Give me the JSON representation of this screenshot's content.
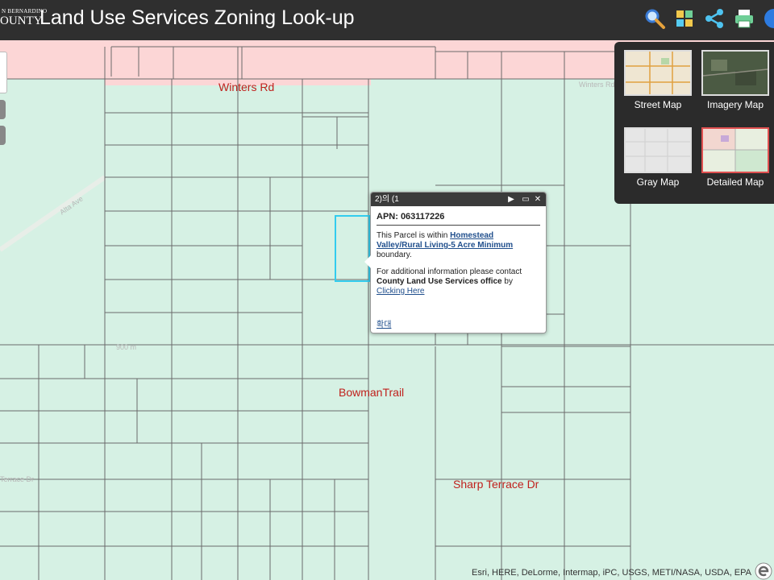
{
  "header": {
    "logo_line1": "N BERNARDINO",
    "logo_line2": "OUNTY",
    "title": "Land Use Services Zoning Look-up"
  },
  "toolbar": {
    "icons": [
      "search-icon",
      "basemap-gallery-icon",
      "share-icon",
      "print-icon",
      "info-icon"
    ]
  },
  "basemaps": [
    {
      "label": "Street Map",
      "selected": false
    },
    {
      "label": "Imagery Map",
      "selected": false
    },
    {
      "label": "Gray Map",
      "selected": false
    },
    {
      "label": "Detailed Map",
      "selected": true
    }
  ],
  "map": {
    "labels": {
      "winters_rd": "Winters Rd",
      "bowman_trail": "BowmanTrail",
      "sharp_terrace": "Sharp Terrace Dr"
    },
    "faint_labels": {
      "winters_rd_right": "Winters Rd",
      "alta_ave": "Alta Ave",
      "terrace": "Terrace Dr",
      "elev": "900 m"
    },
    "colors": {
      "zone_pink": "#fcd6d6",
      "zone_green": "#d6f1e4",
      "parcel_line": "#6b6b6b",
      "selected_parcel": "#33ccee"
    }
  },
  "popup": {
    "title": "2)의 (1",
    "apn": "APN: 063117226",
    "within_prefix": "This Parcel is within ",
    "within_link": "Homestead Valley/Rural Living-5 Acre Minimum",
    "within_suffix": " boundary.",
    "contact_prefix": "For additional information please contact ",
    "contact_bold": "County Land Use Services office",
    "contact_by": " by ",
    "contact_link": "Clicking Here",
    "zoom_link": "확대"
  },
  "attribution": "Esri, HERE, DeLorme, Intermap, iPC, USGS, METI/NASA, USDA, EPA"
}
